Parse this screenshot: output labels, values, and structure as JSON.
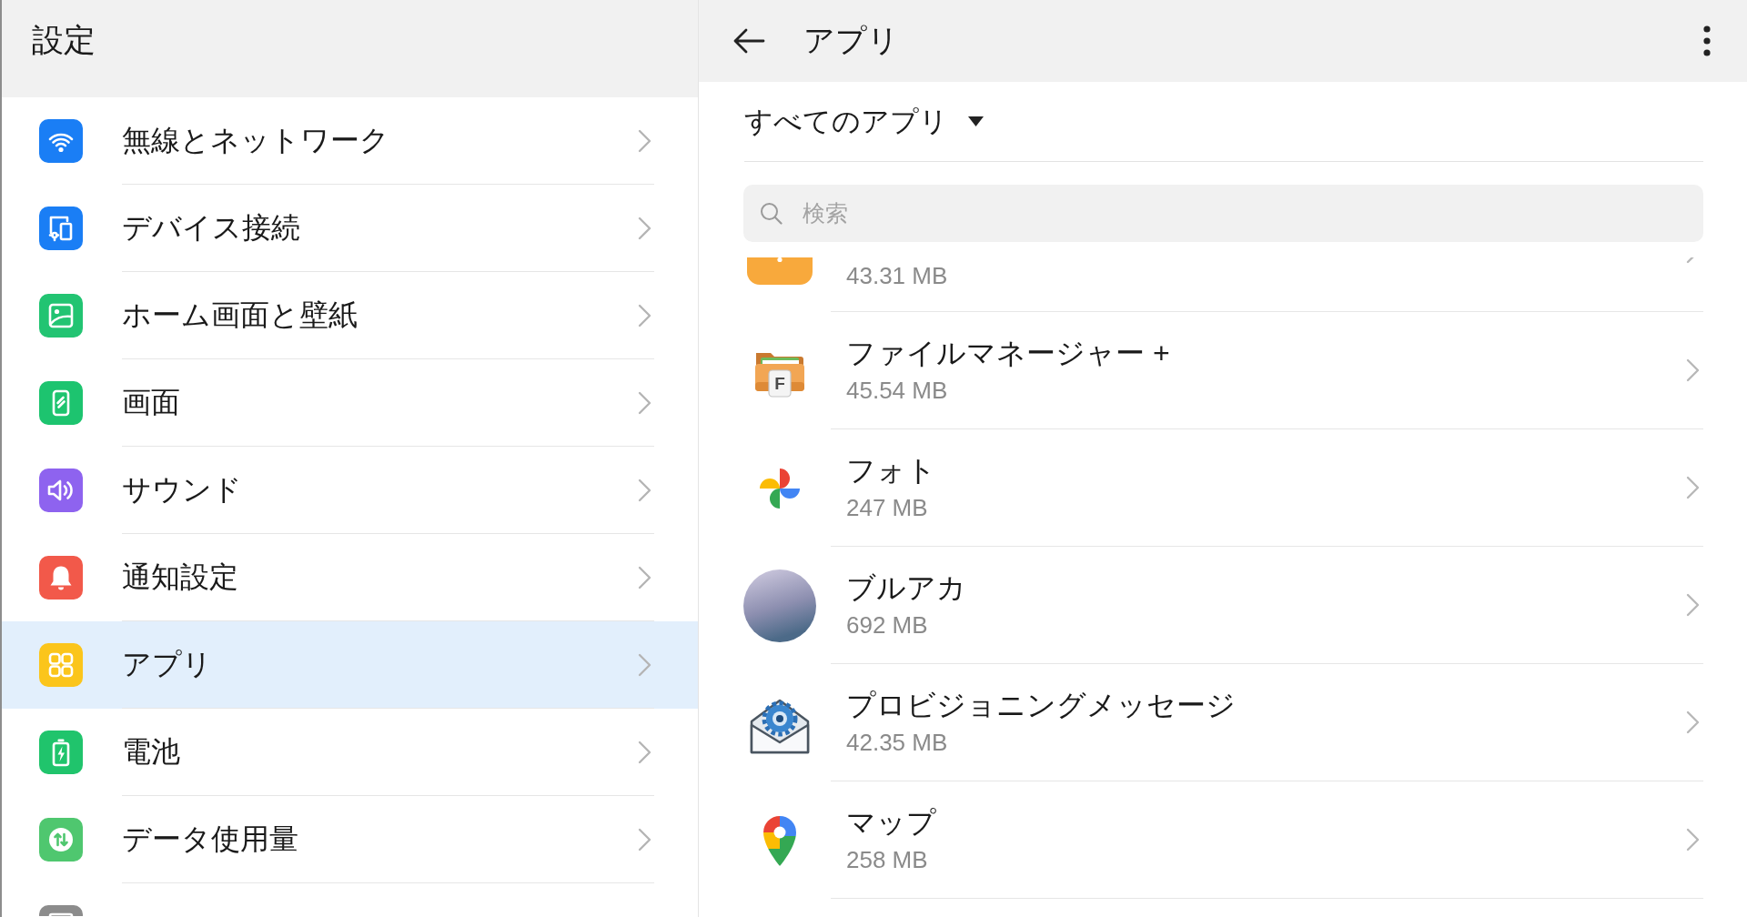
{
  "settings_panel": {
    "title": "設定",
    "items": [
      {
        "label": "無線とネットワーク",
        "color": "#1a7ef5",
        "selected": false
      },
      {
        "label": "デバイス接続",
        "color": "#1a7ef5",
        "selected": false
      },
      {
        "label": "ホーム画面と壁紙",
        "color": "#22c472",
        "selected": false
      },
      {
        "label": "画面",
        "color": "#1dc46f",
        "selected": false
      },
      {
        "label": "サウンド",
        "color": "#8e63ef",
        "selected": false
      },
      {
        "label": "通知設定",
        "color": "#f2594a",
        "selected": false
      },
      {
        "label": "アプリ",
        "color": "#fbc51b",
        "selected": true
      },
      {
        "label": "電池",
        "color": "#20c46c",
        "selected": false
      },
      {
        "label": "データ使用量",
        "color": "#4fc76f",
        "selected": false
      },
      {
        "color": "#8c8c8c",
        "selected": false
      }
    ]
  },
  "apps_panel": {
    "title": "アプリ",
    "filter": "すべてのアプリ",
    "search": {
      "placeholder": "検索"
    },
    "apps": [
      {
        "size": "43.31 MB"
      },
      {
        "name": "ファイルマネージャー +",
        "size": "45.54 MB",
        "icon_letter": "F"
      },
      {
        "name": "フォト",
        "size": "247 MB"
      },
      {
        "name": "ブルアカ",
        "size": "692 MB"
      },
      {
        "name": "プロビジョニングメッセージ",
        "size": "42.35 MB"
      },
      {
        "name": "マップ",
        "size": "258 MB"
      }
    ]
  }
}
